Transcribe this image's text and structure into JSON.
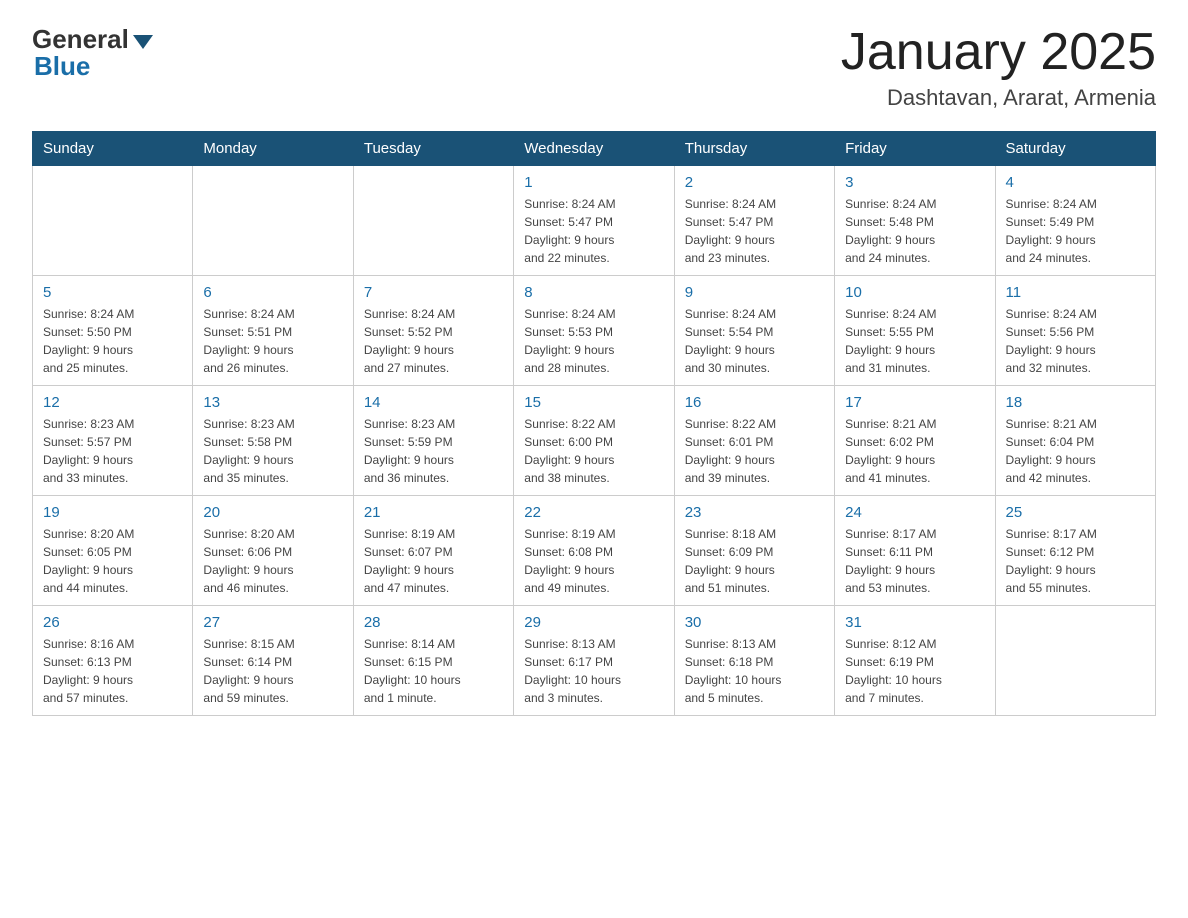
{
  "logo": {
    "general": "General",
    "blue": "Blue"
  },
  "header": {
    "title": "January 2025",
    "subtitle": "Dashtavan, Ararat, Armenia"
  },
  "days_of_week": [
    "Sunday",
    "Monday",
    "Tuesday",
    "Wednesday",
    "Thursday",
    "Friday",
    "Saturday"
  ],
  "weeks": [
    [
      {
        "day": "",
        "info": ""
      },
      {
        "day": "",
        "info": ""
      },
      {
        "day": "",
        "info": ""
      },
      {
        "day": "1",
        "info": "Sunrise: 8:24 AM\nSunset: 5:47 PM\nDaylight: 9 hours\nand 22 minutes."
      },
      {
        "day": "2",
        "info": "Sunrise: 8:24 AM\nSunset: 5:47 PM\nDaylight: 9 hours\nand 23 minutes."
      },
      {
        "day": "3",
        "info": "Sunrise: 8:24 AM\nSunset: 5:48 PM\nDaylight: 9 hours\nand 24 minutes."
      },
      {
        "day": "4",
        "info": "Sunrise: 8:24 AM\nSunset: 5:49 PM\nDaylight: 9 hours\nand 24 minutes."
      }
    ],
    [
      {
        "day": "5",
        "info": "Sunrise: 8:24 AM\nSunset: 5:50 PM\nDaylight: 9 hours\nand 25 minutes."
      },
      {
        "day": "6",
        "info": "Sunrise: 8:24 AM\nSunset: 5:51 PM\nDaylight: 9 hours\nand 26 minutes."
      },
      {
        "day": "7",
        "info": "Sunrise: 8:24 AM\nSunset: 5:52 PM\nDaylight: 9 hours\nand 27 minutes."
      },
      {
        "day": "8",
        "info": "Sunrise: 8:24 AM\nSunset: 5:53 PM\nDaylight: 9 hours\nand 28 minutes."
      },
      {
        "day": "9",
        "info": "Sunrise: 8:24 AM\nSunset: 5:54 PM\nDaylight: 9 hours\nand 30 minutes."
      },
      {
        "day": "10",
        "info": "Sunrise: 8:24 AM\nSunset: 5:55 PM\nDaylight: 9 hours\nand 31 minutes."
      },
      {
        "day": "11",
        "info": "Sunrise: 8:24 AM\nSunset: 5:56 PM\nDaylight: 9 hours\nand 32 minutes."
      }
    ],
    [
      {
        "day": "12",
        "info": "Sunrise: 8:23 AM\nSunset: 5:57 PM\nDaylight: 9 hours\nand 33 minutes."
      },
      {
        "day": "13",
        "info": "Sunrise: 8:23 AM\nSunset: 5:58 PM\nDaylight: 9 hours\nand 35 minutes."
      },
      {
        "day": "14",
        "info": "Sunrise: 8:23 AM\nSunset: 5:59 PM\nDaylight: 9 hours\nand 36 minutes."
      },
      {
        "day": "15",
        "info": "Sunrise: 8:22 AM\nSunset: 6:00 PM\nDaylight: 9 hours\nand 38 minutes."
      },
      {
        "day": "16",
        "info": "Sunrise: 8:22 AM\nSunset: 6:01 PM\nDaylight: 9 hours\nand 39 minutes."
      },
      {
        "day": "17",
        "info": "Sunrise: 8:21 AM\nSunset: 6:02 PM\nDaylight: 9 hours\nand 41 minutes."
      },
      {
        "day": "18",
        "info": "Sunrise: 8:21 AM\nSunset: 6:04 PM\nDaylight: 9 hours\nand 42 minutes."
      }
    ],
    [
      {
        "day": "19",
        "info": "Sunrise: 8:20 AM\nSunset: 6:05 PM\nDaylight: 9 hours\nand 44 minutes."
      },
      {
        "day": "20",
        "info": "Sunrise: 8:20 AM\nSunset: 6:06 PM\nDaylight: 9 hours\nand 46 minutes."
      },
      {
        "day": "21",
        "info": "Sunrise: 8:19 AM\nSunset: 6:07 PM\nDaylight: 9 hours\nand 47 minutes."
      },
      {
        "day": "22",
        "info": "Sunrise: 8:19 AM\nSunset: 6:08 PM\nDaylight: 9 hours\nand 49 minutes."
      },
      {
        "day": "23",
        "info": "Sunrise: 8:18 AM\nSunset: 6:09 PM\nDaylight: 9 hours\nand 51 minutes."
      },
      {
        "day": "24",
        "info": "Sunrise: 8:17 AM\nSunset: 6:11 PM\nDaylight: 9 hours\nand 53 minutes."
      },
      {
        "day": "25",
        "info": "Sunrise: 8:17 AM\nSunset: 6:12 PM\nDaylight: 9 hours\nand 55 minutes."
      }
    ],
    [
      {
        "day": "26",
        "info": "Sunrise: 8:16 AM\nSunset: 6:13 PM\nDaylight: 9 hours\nand 57 minutes."
      },
      {
        "day": "27",
        "info": "Sunrise: 8:15 AM\nSunset: 6:14 PM\nDaylight: 9 hours\nand 59 minutes."
      },
      {
        "day": "28",
        "info": "Sunrise: 8:14 AM\nSunset: 6:15 PM\nDaylight: 10 hours\nand 1 minute."
      },
      {
        "day": "29",
        "info": "Sunrise: 8:13 AM\nSunset: 6:17 PM\nDaylight: 10 hours\nand 3 minutes."
      },
      {
        "day": "30",
        "info": "Sunrise: 8:13 AM\nSunset: 6:18 PM\nDaylight: 10 hours\nand 5 minutes."
      },
      {
        "day": "31",
        "info": "Sunrise: 8:12 AM\nSunset: 6:19 PM\nDaylight: 10 hours\nand 7 minutes."
      },
      {
        "day": "",
        "info": ""
      }
    ]
  ]
}
